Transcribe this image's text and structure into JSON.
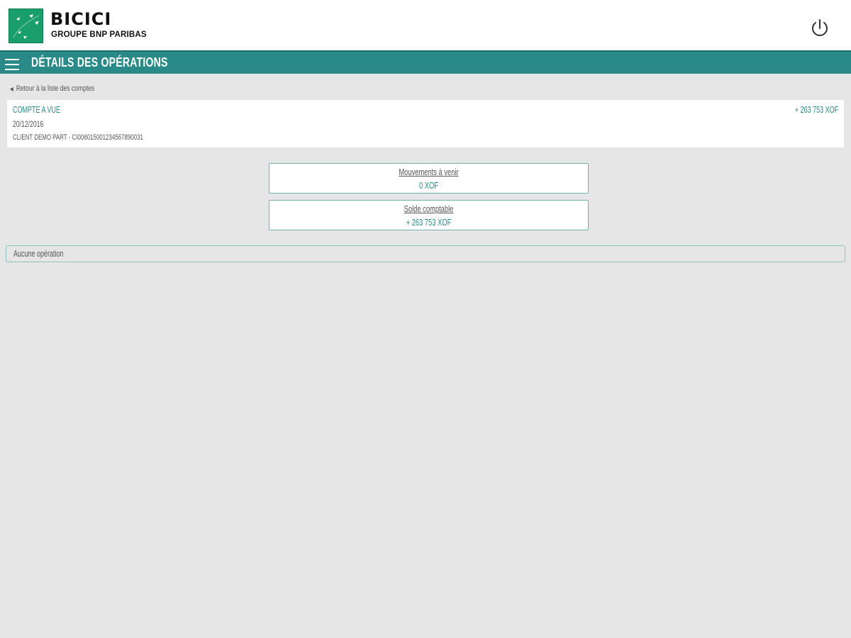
{
  "brand": {
    "name": "BICICI",
    "subtitle": "GROUPE BNP PARIBAS",
    "logo_color": "#1a9e6b"
  },
  "header": {
    "title": "DÉTAILS DES OPÉRATIONS",
    "menu_icon": "hamburger-icon",
    "power_icon": "power-icon",
    "bar_color": "#2a8a88"
  },
  "back_link": {
    "label": "Retour à la liste des comptes",
    "icon": "chevron-left-icon"
  },
  "account": {
    "type": "COMPTE A VUE",
    "date": "20/12/2016",
    "client": "CLIENT DEMO PART - CI006015001234567890031",
    "balance": "+ 263 753 XOF"
  },
  "summary": {
    "movements_label": "Mouvements à venir",
    "movements_value": "0 XOF",
    "balance_label": "Solde comptable",
    "balance_value": "+ 263 753 XOF"
  },
  "operations": {
    "empty_text": "Aucune opération"
  }
}
